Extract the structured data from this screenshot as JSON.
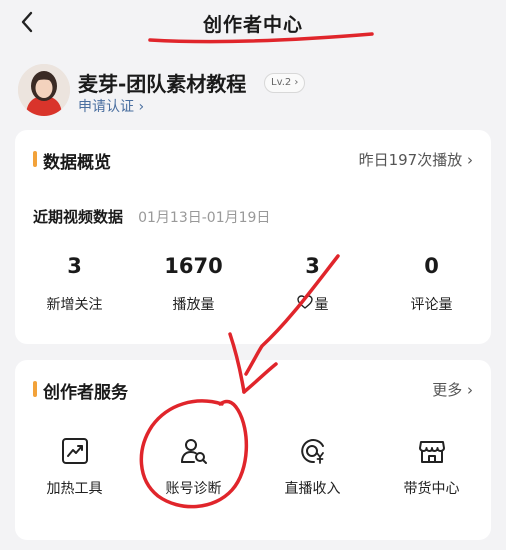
{
  "header": {
    "title": "创作者中心"
  },
  "profile": {
    "username": "麦芽-团队素材教程",
    "level": "Lv.2 ›",
    "verify_link": "申请认证 ›"
  },
  "overview": {
    "title": "数据概览",
    "action": "昨日197次播放 ›",
    "period_label": "近期视频数据",
    "period_range": "01月13日-01月19日",
    "stats": [
      {
        "value": "3",
        "label": "新增关注"
      },
      {
        "value": "1670",
        "label": "播放量"
      },
      {
        "value": "3",
        "label": "量",
        "icon": "heart-icon"
      },
      {
        "value": "0",
        "label": "评论量"
      }
    ]
  },
  "services": {
    "title": "创作者服务",
    "action": "更多 ›",
    "items": [
      {
        "label": "加热工具",
        "icon": "trending-chart-icon"
      },
      {
        "label": "账号诊断",
        "icon": "user-search-icon"
      },
      {
        "label": "直播收入",
        "icon": "live-income-icon"
      },
      {
        "label": "带货中心",
        "icon": "storefront-icon"
      }
    ]
  },
  "colors": {
    "accent": "#f2a23a",
    "link": "#4a6fa0",
    "annotation": "#e0252b",
    "background": "#f3f3f5"
  }
}
